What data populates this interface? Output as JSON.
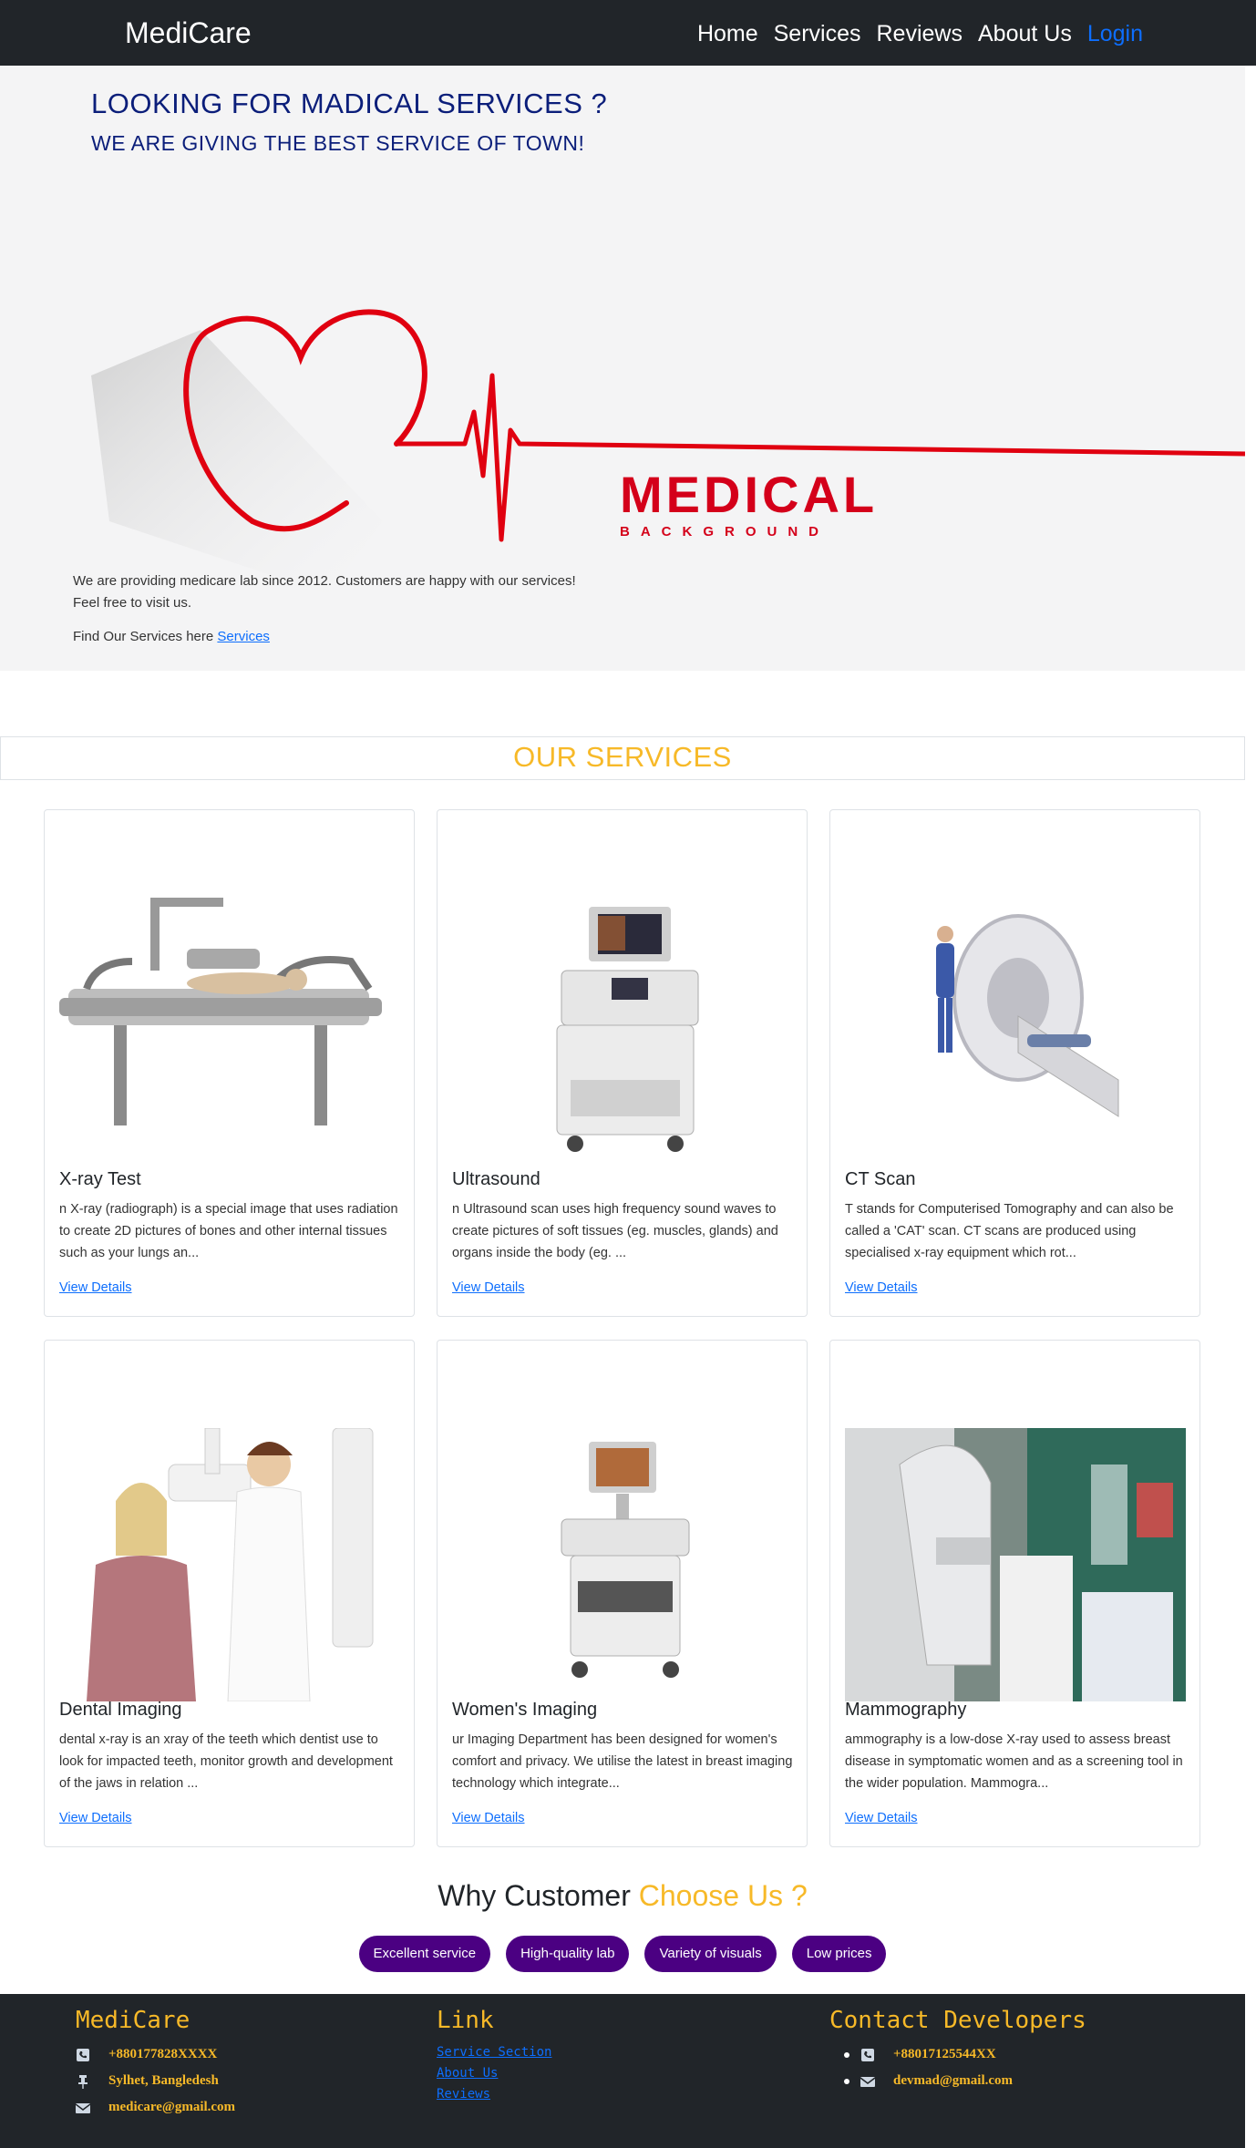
{
  "nav": {
    "brand": "MediCare",
    "links": [
      "Home",
      "Services",
      "Reviews",
      "About Us"
    ],
    "login": "Login"
  },
  "hero": {
    "title": "LOOKING FOR MADICAL SERVICES ?",
    "subtitle": "WE ARE GIVING THE BEST SERVICE OF TOWN!",
    "art_word": "MEDICAL",
    "art_sub": "BACKGROUND",
    "para_line1": "We are providing medicare lab since 2012. Customers are happy with our services!",
    "para_line2": "Feel free to visit us.",
    "find_text": "Find Our Services here",
    "find_link": "Services"
  },
  "services": {
    "heading": "OUR SERVICES",
    "cards": [
      {
        "title": "X-ray Test",
        "text": "n X-ray (radiograph) is a special image that uses radiation to create 2D pictures of bones and other internal tissues such as your lungs an...",
        "link": "View Details",
        "icon": "xray-machine-image"
      },
      {
        "title": "Ultrasound",
        "text": "n Ultrasound scan uses high frequency sound waves to create pictures of soft tissues (eg. muscles, glands) and organs inside the body (eg. ...",
        "link": "View Details",
        "icon": "ultrasound-machine-image"
      },
      {
        "title": "CT Scan",
        "text": "T stands for Computerised Tomography and can also be called a 'CAT' scan. CT scans are produced using specialised x-ray equipment which rot...",
        "link": "View Details",
        "icon": "ct-scanner-image"
      },
      {
        "title": "Dental Imaging",
        "text": "dental x-ray is an xray of the teeth which dentist use to look for impacted teeth, monitor growth and development of the jaws in relation ...",
        "link": "View Details",
        "icon": "dental-xray-image"
      },
      {
        "title": "Women's Imaging",
        "text": "ur Imaging Department has been designed for women's comfort and privacy. We utilise the latest in breast imaging technology which integrate...",
        "link": "View Details",
        "icon": "womens-imaging-image"
      },
      {
        "title": "Mammography",
        "text": "ammography is a low-dose X-ray used to assess breast disease in symptomatic women and as a screening tool in the wider population. Mammogra...",
        "link": "View Details",
        "icon": "mammography-image"
      }
    ]
  },
  "why": {
    "prefix": "Why Customer",
    "accent": "Choose Us ?",
    "pills": [
      "Excellent service",
      "High-quality lab",
      "Variety of visuals",
      "Low prices"
    ]
  },
  "footer": {
    "brand": "MediCare",
    "phone": "+880177828XXXX",
    "address": "Sylhet, Bangledesh",
    "email": "medicare@gmail.com",
    "link_heading": "Link",
    "links": [
      "Service Section",
      "About Us",
      "Reviews"
    ],
    "dev_heading": "Contact Developers",
    "dev_phone": "+88017125544XX",
    "dev_email": "devmad@gmail.com"
  },
  "colors": {
    "navbar": "#212529",
    "accent": "#f7b928",
    "hero_title": "#0b1e7a",
    "pill": "#4b0082",
    "link": "#0d6efd",
    "heart_red": "#e00010"
  }
}
